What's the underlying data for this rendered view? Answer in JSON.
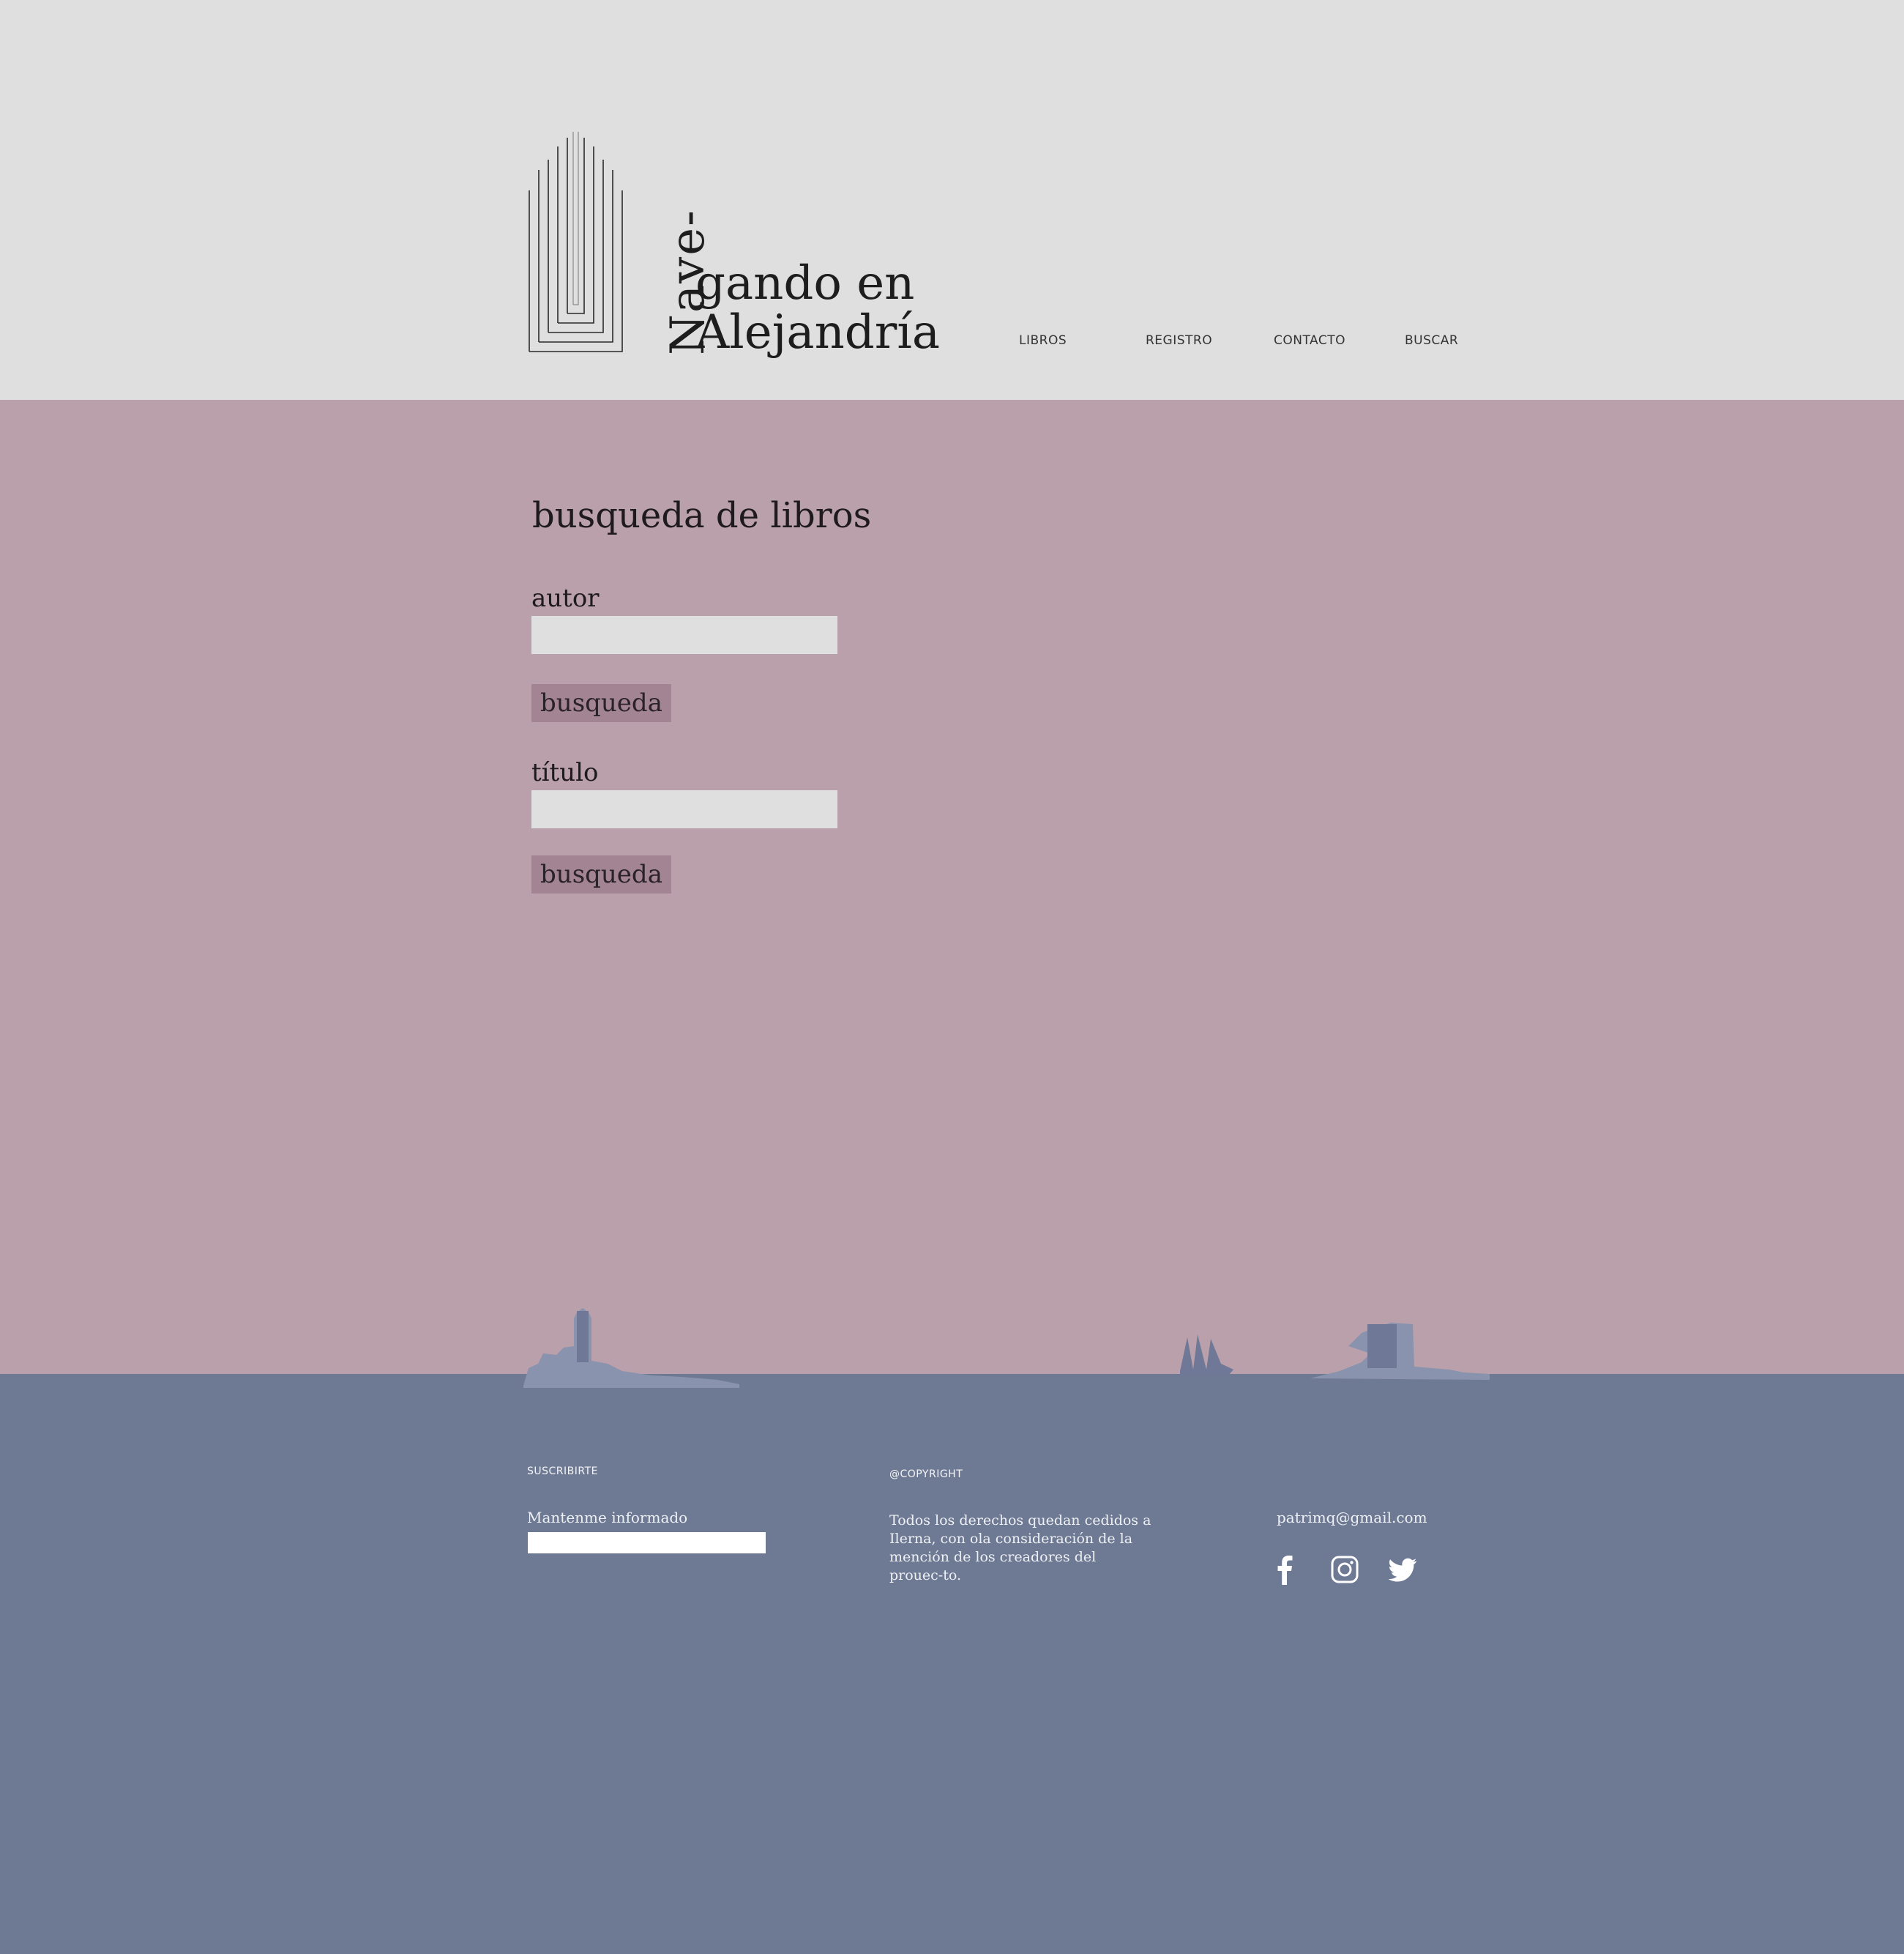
{
  "brand": {
    "logo_vertical": "Nave-",
    "logo_line1": "gando en",
    "logo_line2": "Alejandría"
  },
  "nav": {
    "items": [
      {
        "label": "LIBROS"
      },
      {
        "label": "REGISTRO"
      },
      {
        "label": "CONTACTO"
      },
      {
        "label": "BUSCAR"
      }
    ]
  },
  "main": {
    "title": "busqueda de libros",
    "author": {
      "label": "autor",
      "value": "",
      "button_label": "busqueda"
    },
    "title_field": {
      "label": "título",
      "value": "",
      "button_label": "busqueda"
    }
  },
  "footer": {
    "subscribe": {
      "heading": "SUSCRIBIRTE",
      "label": "Mantenme informado",
      "value": ""
    },
    "copyright": {
      "heading": "@COPYRIGHT",
      "text": "Todos los derechos quedan cedidos a Ilerna, con ola consideración de la mención de los creadores del prouec-to."
    },
    "contact": {
      "email": "patrimq@gmail.com"
    },
    "social": [
      {
        "icon": "facebook-icon"
      },
      {
        "icon": "instagram-icon"
      },
      {
        "icon": "twitter-icon"
      }
    ]
  },
  "colors": {
    "header_bg": "#dfdfdf",
    "main_bg": "#baa0ab",
    "footer_bg": "#6e7a94",
    "button_bg": "#a38493",
    "input_bg": "#e0dfe0",
    "silhouette": "#8a93ad"
  }
}
